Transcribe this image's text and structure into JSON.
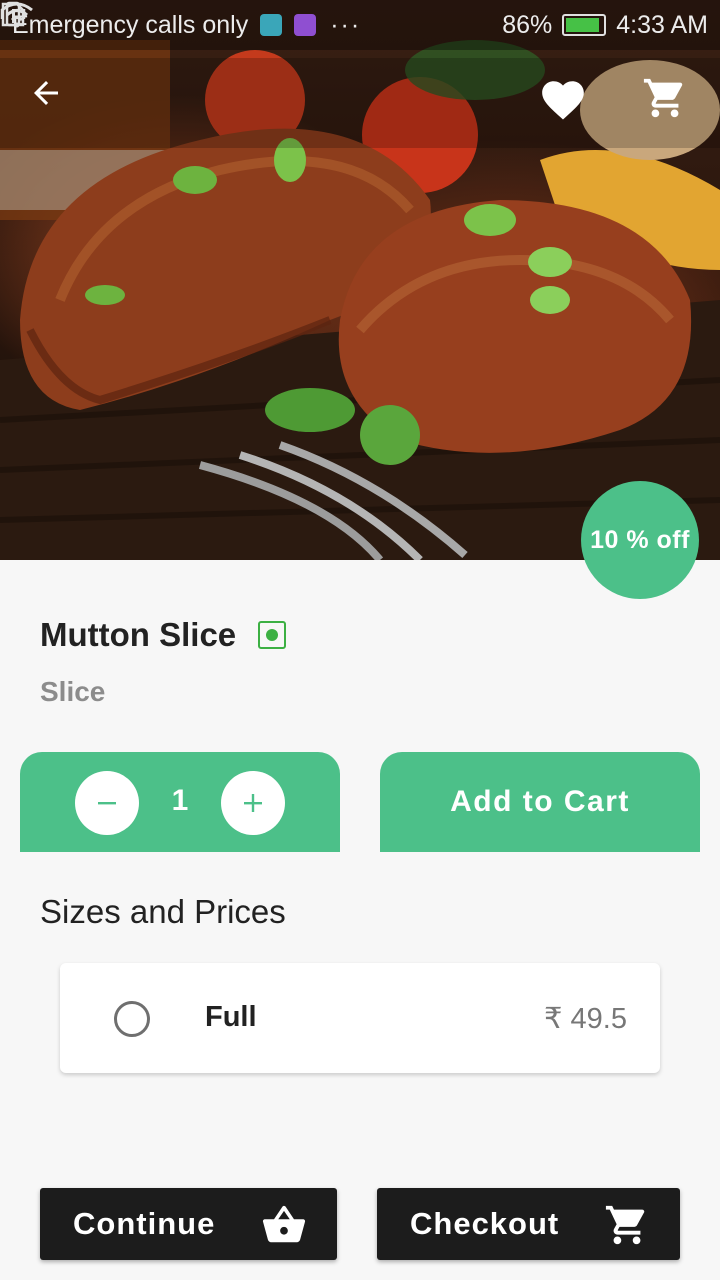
{
  "status_bar": {
    "carrier": "Emergency calls only",
    "dots": "···",
    "battery": "86%",
    "time": "4:33 AM",
    "colors": {
      "notif_icon_1": "#3aa6b9",
      "notif_icon_2": "#8f4fd1",
      "battery_fill": "#46c146"
    }
  },
  "top_bar": {
    "icons": [
      "arrow-back-icon",
      "heart-icon",
      "shopping-cart-icon"
    ]
  },
  "hero": {
    "discount_label": "10 % off"
  },
  "product": {
    "name": "Mutton Slice",
    "category": "Slice",
    "type_indicator": "veg-indicator-icon"
  },
  "quantity": {
    "value": "1",
    "minus_label": "−",
    "plus_label": "+"
  },
  "actions": {
    "add_to_cart_label": "Add to Cart"
  },
  "sizes": {
    "title": "Sizes and Prices",
    "items": [
      {
        "name": "Full",
        "price": "₹ 49.5",
        "selected": false
      }
    ]
  },
  "bottom": {
    "continue_label": "Continue",
    "checkout_label": "Checkout"
  },
  "colors": {
    "accent": "#4cc089",
    "dark_button": "#1c1c1c",
    "background": "#f7f7f7"
  }
}
